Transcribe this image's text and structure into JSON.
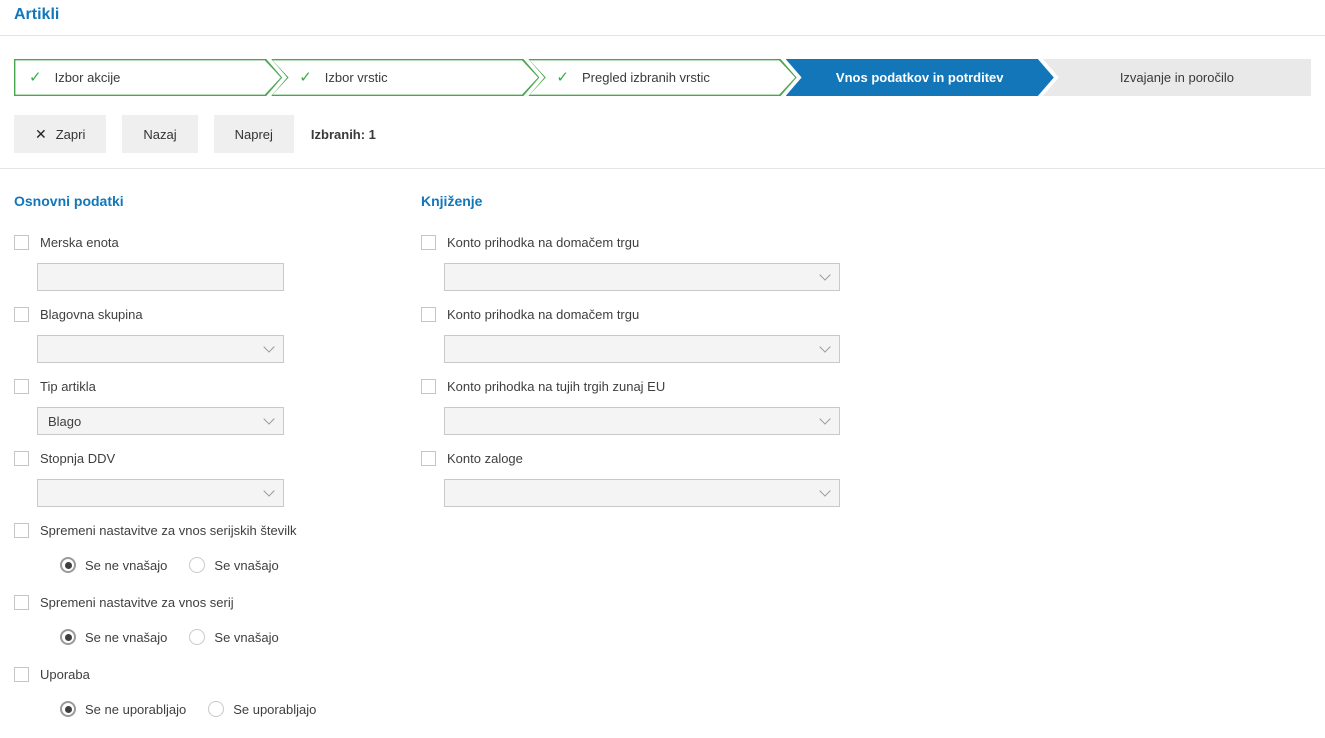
{
  "page": {
    "title": "Artikli"
  },
  "icons": {
    "check": "✓",
    "close": "✕"
  },
  "colors": {
    "accent_blue": "#1276b9",
    "step_done_border": "#4aa64e",
    "check_green": "#3baa44",
    "step_upcoming_bg": "#e9e9e9",
    "button_bg": "#efefef",
    "input_bg": "#f4f4f4",
    "input_border": "#c9c9c9"
  },
  "stepper": {
    "steps": [
      {
        "label": "Izbor akcije",
        "state": "done"
      },
      {
        "label": "Izbor vrstic",
        "state": "done"
      },
      {
        "label": "Pregled izbranih vrstic",
        "state": "done"
      },
      {
        "label": "Vnos podatkov in potrditev",
        "state": "active"
      },
      {
        "label": "Izvajanje in poročilo",
        "state": "upcoming"
      }
    ]
  },
  "toolbar": {
    "close_label": "Zapri",
    "back_label": "Nazaj",
    "next_label": "Naprej",
    "selected_count_label": "Izbranih: 1"
  },
  "sections": [
    {
      "heading": "Osnovni podatki",
      "fields": [
        {
          "type": "text",
          "label": "Merska enota",
          "checked": false,
          "value": ""
        },
        {
          "type": "select",
          "label": "Blagovna skupina",
          "checked": false,
          "value": ""
        },
        {
          "type": "select",
          "label": "Tip artikla",
          "checked": false,
          "value": "Blago"
        },
        {
          "type": "select",
          "label": "Stopnja DDV",
          "checked": false,
          "value": ""
        },
        {
          "type": "radio",
          "label": "Spremeni nastavitve za vnos serijskih številk",
          "checked": false,
          "options": [
            "Se ne vnašajo",
            "Se vnašajo"
          ],
          "selected": 0
        },
        {
          "type": "radio",
          "label": "Spremeni nastavitve za vnos serij",
          "checked": false,
          "options": [
            "Se ne vnašajo",
            "Se vnašajo"
          ],
          "selected": 0
        },
        {
          "type": "radio",
          "label": "Uporaba",
          "checked": false,
          "options": [
            "Se ne uporabljajo",
            "Se uporabljajo"
          ],
          "selected": 0
        }
      ]
    },
    {
      "heading": "Knjiženje",
      "fields": [
        {
          "type": "select",
          "label": "Konto prihodka na domačem trgu",
          "checked": false,
          "value": ""
        },
        {
          "type": "select",
          "label": "Konto prihodka na domačem trgu",
          "checked": false,
          "value": ""
        },
        {
          "type": "select",
          "label": "Konto prihodka na tujih trgih zunaj EU",
          "checked": false,
          "value": ""
        },
        {
          "type": "select",
          "label": "Konto zaloge",
          "checked": false,
          "value": ""
        }
      ]
    }
  ]
}
